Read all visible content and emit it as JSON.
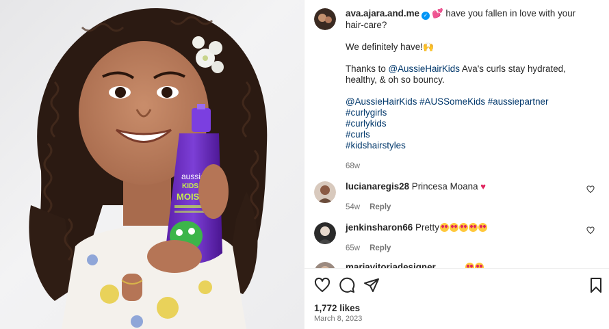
{
  "post": {
    "photo_alt": "girl with curly hair holding aussie kids spray bottle",
    "bottle_brand": "aussie",
    "bottle_line": "KIDS",
    "bottle_product": "MOIST"
  },
  "caption": {
    "username": "ava.ajara.and.me",
    "line1": "💕 have you fallen in love with your hair-care?",
    "line2": "We definitely have!🙌",
    "line3_pre": "Thanks to ",
    "line3_mention": "@AussieHairKids",
    "line3_post": " Ava's curls stay hydrated, healthy, & oh so bouncy.",
    "tags_line": "@AussieHairKids #AUSSomeKids #aussiepartner",
    "tags": [
      "#curlygirls",
      "#curlykids",
      "#curls",
      "#kidshairstyles"
    ],
    "age": "68w"
  },
  "comments": [
    {
      "username": "lucianaregis28",
      "text": "Princesa Moana",
      "age": "54w",
      "reply": "Reply"
    },
    {
      "username": "jenkinsharon66",
      "text": "Pretty",
      "age": "65w",
      "reply": "Reply"
    },
    {
      "username": "mariavitoriadesigner",
      "text": "",
      "age": "",
      "reply": ""
    }
  ],
  "footer": {
    "likes": "1,772 likes",
    "date": "March 8, 2023"
  },
  "icons": {
    "like": "heart-icon",
    "comment": "comment-icon",
    "share": "share-icon",
    "save": "bookmark-icon"
  },
  "colors": {
    "link": "#00376b",
    "verified": "#0095f6",
    "muted": "#737373"
  }
}
